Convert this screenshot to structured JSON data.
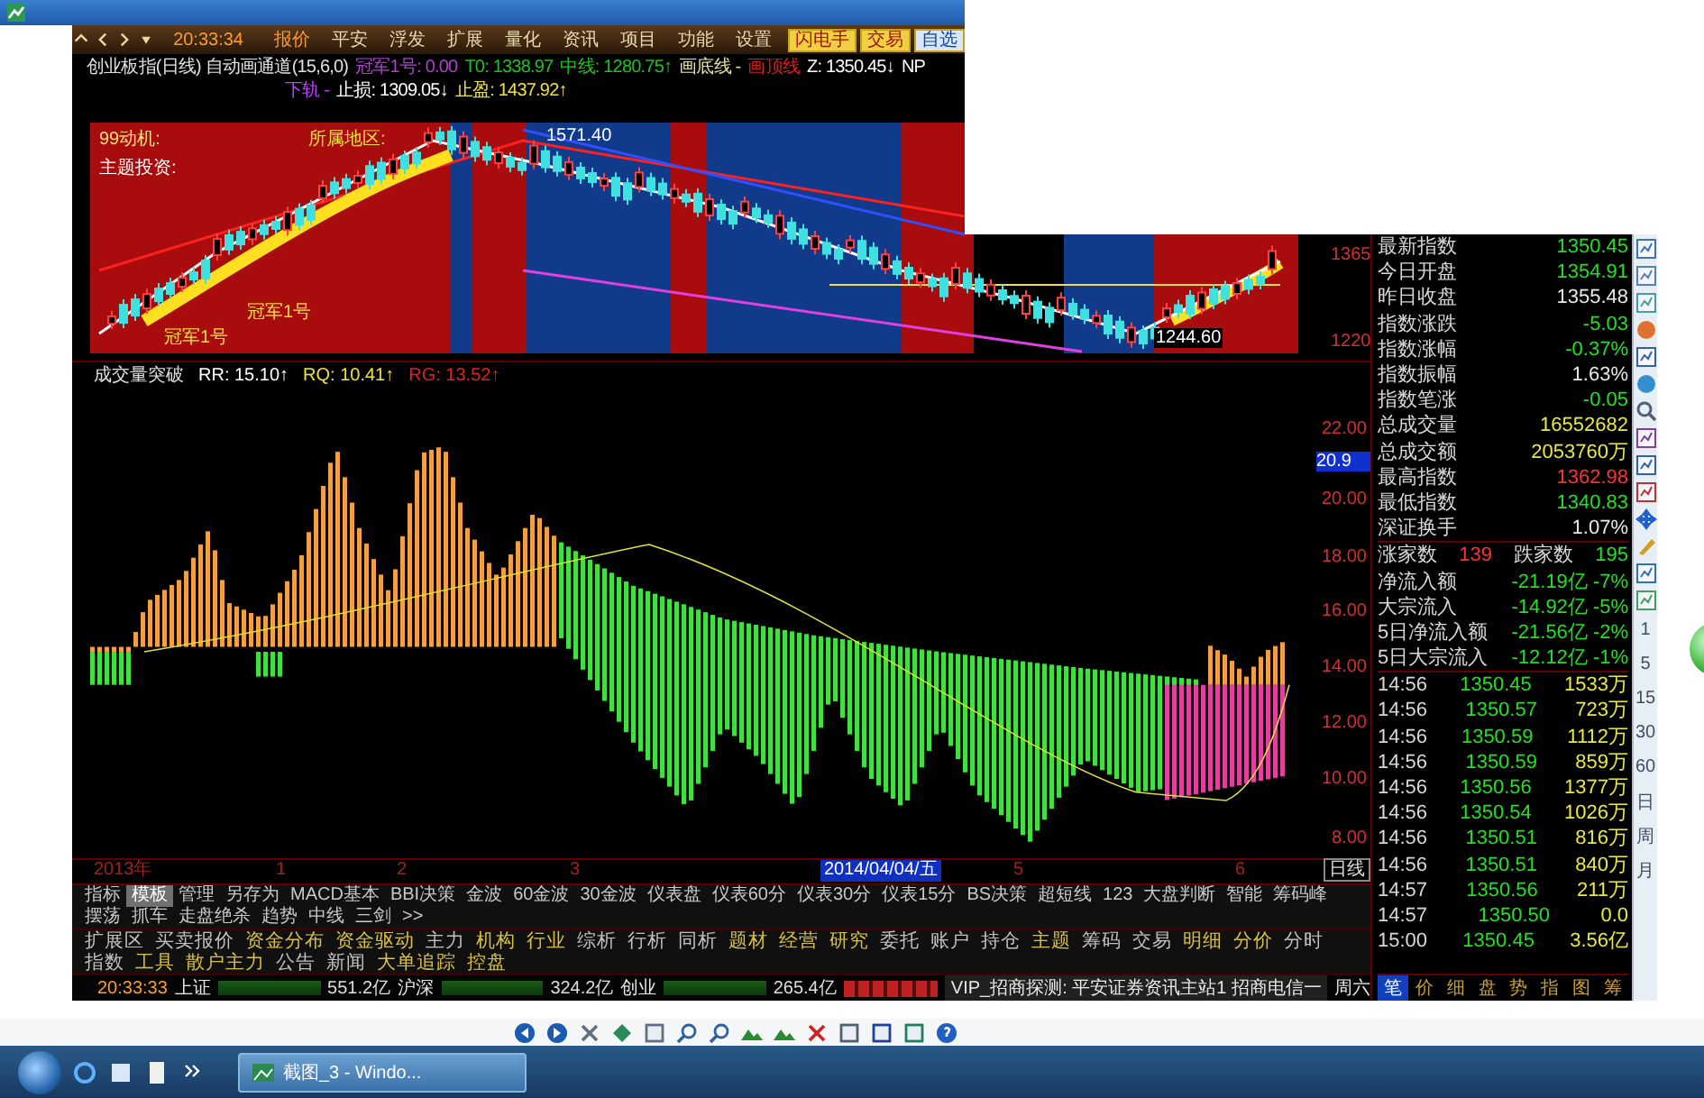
{
  "toolbar": {
    "time": "20:33:34",
    "menu": [
      {
        "label": "报价",
        "selected": true
      },
      {
        "label": "平安",
        "selected": false
      },
      {
        "label": "浮发",
        "selected": false
      },
      {
        "label": "扩展",
        "selected": false
      },
      {
        "label": "量化",
        "selected": false
      },
      {
        "label": "资讯",
        "selected": false
      },
      {
        "label": "项目",
        "selected": false
      },
      {
        "label": "功能",
        "selected": false
      },
      {
        "label": "设置",
        "selected": false
      }
    ],
    "actions": [
      "闪电手",
      "交易",
      "自选"
    ]
  },
  "chart_header": {
    "title": "创业板指(日线) 自动画通道(15,6,0)",
    "line_1": [
      {
        "label": "冠军1号: 0.00",
        "color": "#b040d0"
      },
      {
        "label": "T0: 1338.97",
        "color": "#20c020"
      },
      {
        "label": "中线: 1280.75↑",
        "color": "#20c020"
      },
      {
        "label": "画底线 -",
        "color": "#e0e0a0"
      },
      {
        "label": "画顶线",
        "color": "#d02020"
      },
      {
        "label": "Z: 1350.45↓",
        "color": "#ffffff"
      },
      {
        "label": "NP",
        "color": "#ffffff"
      }
    ],
    "line_2": [
      {
        "label": "下轨 -",
        "color": "#c040ff"
      },
      {
        "label": "止损: 1309.05↓",
        "color": "#ffffff"
      },
      {
        "label": "止盈: 1437.92↑",
        "color": "#f0e040"
      }
    ]
  },
  "main_chart": {
    "labels": [
      "99动机:",
      "所属地区:",
      "主题投资:",
      "1571.40",
      "冠军1号",
      "冠军1号",
      "1244.60"
    ],
    "axis_labels": [
      "1365",
      "1220"
    ]
  },
  "indicator": {
    "title": "成交量突破",
    "readings": [
      {
        "label": "RR: 15.10↑",
        "color": "#ffffff"
      },
      {
        "label": "RQ: 10.41↑",
        "color": "#f0e040"
      },
      {
        "label": "RG: 13.52↑",
        "color": "#e02020"
      }
    ],
    "axis_labels": [
      "22.00",
      "20.00",
      "18.00",
      "16.00",
      "14.00",
      "12.00",
      "10.00",
      "8.00"
    ],
    "marker": "20.9"
  },
  "date_axis": {
    "labels": [
      {
        "label": "2013年",
        "selected": false
      },
      {
        "label": "1",
        "selected": false
      },
      {
        "label": "2",
        "selected": false
      },
      {
        "label": "3",
        "selected": false
      },
      {
        "label": "2014/04/04/五",
        "selected": true
      },
      {
        "label": "5",
        "selected": false
      },
      {
        "label": "6",
        "selected": false
      }
    ],
    "period": "日线"
  },
  "indicator_tabs": [
    {
      "label": "指标",
      "selected": false
    },
    {
      "label": "模板",
      "selected": true
    },
    {
      "label": "管理",
      "selected": false
    },
    {
      "label": "另存为",
      "selected": false
    },
    {
      "label": "MACD基本",
      "selected": false
    },
    {
      "label": "BBI决策",
      "selected": false
    },
    {
      "label": "金波",
      "selected": false
    },
    {
      "label": "60金波",
      "selected": false
    },
    {
      "label": "30金波",
      "selected": false
    },
    {
      "label": "仪表盘",
      "selected": false
    },
    {
      "label": "仪表60分",
      "selected": false
    },
    {
      "label": "仪表30分",
      "selected": false
    },
    {
      "label": "仪表15分",
      "selected": false
    },
    {
      "label": "BS决策",
      "selected": false
    },
    {
      "label": "超短线",
      "selected": false
    },
    {
      "label": "123",
      "selected": false
    },
    {
      "label": "大盘判断",
      "selected": false
    },
    {
      "label": "智能",
      "selected": false
    },
    {
      "label": "筹码峰",
      "selected": false
    },
    {
      "label": "摆荡",
      "selected": false
    },
    {
      "label": "抓车",
      "selected": false
    },
    {
      "label": "走盘绝杀",
      "selected": false
    },
    {
      "label": "趋势",
      "selected": false
    },
    {
      "label": "中线",
      "selected": false
    },
    {
      "label": "三剑",
      "selected": false
    },
    {
      "label": ">>",
      "selected": false
    }
  ],
  "feature_tabs": [
    {
      "label": "扩展区",
      "color": "#c0c0c0"
    },
    {
      "label": "买卖报价",
      "color": "#c0c0c0"
    },
    {
      "label": "资金分布",
      "color": "#d8c040"
    },
    {
      "label": "资金驱动",
      "color": "#d8c040"
    },
    {
      "label": "主力",
      "color": "#c0c0c0"
    },
    {
      "label": "机构",
      "color": "#d8c040"
    },
    {
      "label": "行业",
      "color": "#d8c040"
    },
    {
      "label": "综析",
      "color": "#c0c0c0"
    },
    {
      "label": "行析",
      "color": "#c0c0c0"
    },
    {
      "label": "同析",
      "color": "#c0c0c0"
    },
    {
      "label": "题材",
      "color": "#d8c040"
    },
    {
      "label": "经营",
      "color": "#d8c040"
    },
    {
      "label": "研究",
      "color": "#d8c040"
    },
    {
      "label": "委托",
      "color": "#c0c0c0"
    },
    {
      "label": "账户",
      "color": "#c0c0c0"
    },
    {
      "label": "持仓",
      "color": "#c0c0c0"
    },
    {
      "label": "主题",
      "color": "#d8c040"
    },
    {
      "label": "筹码",
      "color": "#c0c0c0"
    },
    {
      "label": "交易",
      "color": "#c0c0c0"
    },
    {
      "label": "明细",
      "color": "#d8c040"
    },
    {
      "label": "分价",
      "color": "#d8c040"
    },
    {
      "label": "分时",
      "color": "#c0c0c0"
    },
    {
      "label": "指数",
      "color": "#c0c0c0"
    },
    {
      "label": "工具",
      "color": "#d8c040"
    },
    {
      "label": "散户主力",
      "color": "#d8c040"
    },
    {
      "label": "公告",
      "color": "#c0c0c0"
    },
    {
      "label": "新闻",
      "color": "#c0c0c0"
    },
    {
      "label": "大单追踪",
      "color": "#d8c040"
    },
    {
      "label": "控盘",
      "color": "#d8c040"
    }
  ],
  "status_bar": {
    "time": "20:33:33",
    "markets": [
      {
        "name": "上证",
        "amount": "551.2亿"
      },
      {
        "name": "沪深",
        "amount": "324.2亿"
      },
      {
        "name": "创业",
        "amount": "265.4亿"
      }
    ],
    "ticker": "VIP_招商探测: 平安证券资讯主站1 招商电信一",
    "day": "周六"
  },
  "quote_panel": {
    "stats": [
      {
        "label": "最新指数",
        "value": "1350.45",
        "color": "#20e020"
      },
      {
        "label": "今日开盘",
        "value": "1354.91",
        "color": "#20e020"
      },
      {
        "label": "昨日收盘",
        "value": "1355.48",
        "color": "#e8e8e8"
      },
      {
        "label": "指数涨跌",
        "value": "-5.03",
        "color": "#20e020"
      },
      {
        "label": "指数涨幅",
        "value": "-0.37%",
        "color": "#20e020"
      },
      {
        "label": "指数振幅",
        "value": "1.63%",
        "color": "#e8e8e8"
      },
      {
        "label": "指数笔涨",
        "value": "-0.05",
        "color": "#20e020"
      },
      {
        "label": "总成交量",
        "value": "16552682",
        "color": "#e8e840"
      },
      {
        "label": "总成交额",
        "value": "2053760万",
        "color": "#e8e840"
      },
      {
        "label": "最高指数",
        "value": "1362.98",
        "color": "#ff3030"
      },
      {
        "label": "最低指数",
        "value": "1340.83",
        "color": "#20e020"
      },
      {
        "label": "深证换手",
        "value": "1.07%",
        "color": "#e8e8e8"
      }
    ],
    "breadth": {
      "up_label": "涨家数",
      "up": "139",
      "down_label": "跌家数",
      "down": "195"
    },
    "flows": [
      {
        "label": "净流入额",
        "amount": "-21.19亿",
        "percent": "-7%"
      },
      {
        "label": "大宗流入",
        "amount": "-14.92亿",
        "percent": "-5%"
      },
      {
        "label": "5日净流入额",
        "amount": "-21.56亿",
        "percent": "-2%"
      },
      {
        "label": "5日大宗流入",
        "amount": "-12.12亿",
        "percent": "-1%"
      }
    ],
    "ticks": [
      {
        "time": "14:56",
        "price": "1350.45",
        "volume": "1533万"
      },
      {
        "time": "14:56",
        "price": "1350.57",
        "volume": "723万"
      },
      {
        "time": "14:56",
        "price": "1350.59",
        "volume": "1112万"
      },
      {
        "time": "14:56",
        "price": "1350.59",
        "volume": "859万"
      },
      {
        "time": "14:56",
        "price": "1350.56",
        "volume": "1377万"
      },
      {
        "time": "14:56",
        "price": "1350.54",
        "volume": "1026万"
      },
      {
        "time": "14:56",
        "price": "1350.51",
        "volume": "816万"
      },
      {
        "time": "14:56",
        "price": "1350.51",
        "volume": "840万"
      },
      {
        "time": "14:57",
        "price": "1350.56",
        "volume": "211万"
      },
      {
        "time": "14:57",
        "price": "1350.50",
        "volume": "0.0"
      },
      {
        "time": "15:00",
        "price": "1350.45",
        "volume": "3.56亿"
      }
    ],
    "tabs": [
      {
        "label": "笔",
        "selected": true
      },
      {
        "label": "价",
        "selected": false
      },
      {
        "label": "细",
        "selected": false
      },
      {
        "label": "盘",
        "selected": false
      },
      {
        "label": "势",
        "selected": false
      },
      {
        "label": "指",
        "selected": false
      },
      {
        "label": "图",
        "selected": false
      },
      {
        "label": "筹",
        "selected": false
      }
    ]
  },
  "periods": [
    "1",
    "5",
    "15",
    "30",
    "60",
    "日",
    "周",
    "月"
  ],
  "taskbar": {
    "task": "截图_3 - Windo..."
  }
}
